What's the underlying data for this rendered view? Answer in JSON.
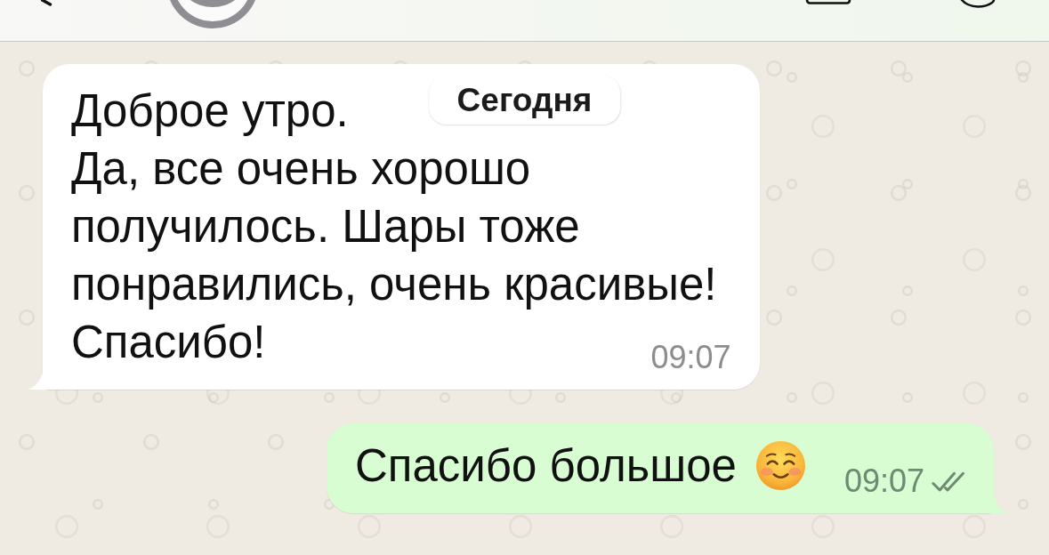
{
  "date_badge": "Сегодня",
  "messages": [
    {
      "kind": "incoming",
      "paragraphs": [
        "Доброе утро.",
        "Да, все очень хорошо\nполучилось. Шары тоже\nпонравились, очень красивые!",
        "Спасибо!"
      ],
      "time": "09:07"
    },
    {
      "kind": "outgoing",
      "paragraphs": [
        "Спасибо большое"
      ],
      "emoji": true,
      "time": "09:07",
      "read": false
    }
  ]
}
